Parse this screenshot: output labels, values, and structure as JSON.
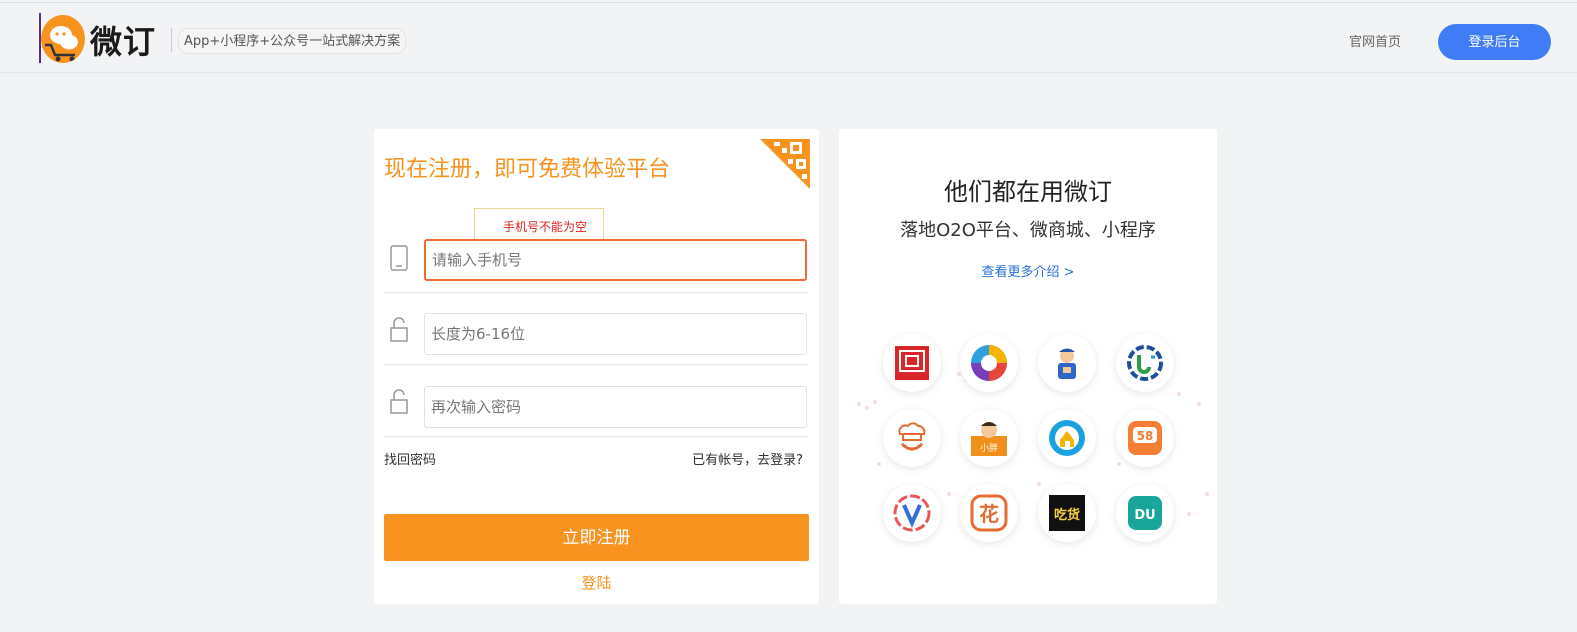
{
  "header": {
    "logo_text": "微订",
    "slogan": "App+小程序+公众号一站式解决方案",
    "nav_home": "官网首页",
    "login_admin": "登录后台"
  },
  "register": {
    "title": "现在注册，即可免费体验平台",
    "tooltip": "手机号不能为空",
    "phone_placeholder": "请输入手机号",
    "password_placeholder": "长度为6-16位",
    "confirm_placeholder": "再次输入密码",
    "forgot": "找回密码",
    "have_account": "已有帐号，去登录?",
    "submit": "立即注册",
    "login": "登陆"
  },
  "showcase": {
    "title": "他们都在用微订",
    "subtitle": "落地O2O平台、微商城、小程序",
    "more": "查看更多介绍 >",
    "apps": [
      {
        "icon": "app-red-seal-icon",
        "text": "回"
      },
      {
        "icon": "app-aperture-icon",
        "text": ""
      },
      {
        "icon": "app-delivery-man-icon",
        "text": ""
      },
      {
        "icon": "app-blue-ring-icon",
        "text": "U"
      },
      {
        "icon": "app-chef-icon",
        "text": ""
      },
      {
        "icon": "app-character-icon",
        "text": "小胖"
      },
      {
        "icon": "app-blue-house-icon",
        "text": ""
      },
      {
        "icon": "app-58-icon",
        "text": "58"
      },
      {
        "icon": "app-v-icon",
        "text": "V"
      },
      {
        "icon": "app-flower-icon",
        "text": "花"
      },
      {
        "icon": "app-foodie-icon",
        "text": "吃货"
      },
      {
        "icon": "app-du-icon",
        "text": "DU"
      }
    ]
  },
  "colors": {
    "accent_orange": "#f7931e",
    "admin_blue": "#3f7cf5",
    "error_red": "#e02020",
    "link_blue": "#2a6fd6"
  }
}
